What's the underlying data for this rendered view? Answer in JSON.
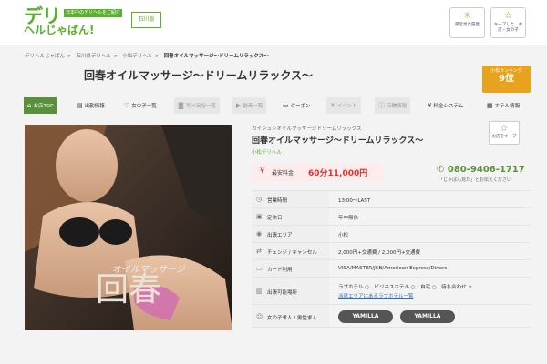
{
  "header": {
    "logo_main": "デリ",
    "logo_tag": "日本中のデリヘルをご紹介",
    "logo_second": "ヘルじゃぱん!",
    "area": "石川版",
    "history_btn": "最近見た履歴",
    "fav_list_btn": "キープした　お店・女の子"
  },
  "breadcrumb": [
    "デリヘルじゃぱん",
    "石川県デリヘル",
    "小松デリヘル",
    "回春オイルマッサージ〜ドリームリラックス〜"
  ],
  "title": "回春オイルマッサージ〜ドリームリラックス〜",
  "rank": {
    "label": "小松ランキング",
    "value": "9位"
  },
  "tabs": [
    {
      "label": "お店TOP",
      "icon": "home-icon"
    },
    {
      "label": "出勤情報",
      "icon": "calendar-icon"
    },
    {
      "label": "女の子一覧",
      "icon": "heart-icon"
    },
    {
      "label": "写メ日記一覧",
      "icon": "camera-icon"
    },
    {
      "label": "動画一覧",
      "icon": "video-icon"
    },
    {
      "label": "クーポン",
      "icon": "coupon-icon"
    },
    {
      "label": "イベント",
      "icon": "event-icon"
    },
    {
      "label": "店舗情報",
      "icon": "info-icon"
    },
    {
      "label": "料金システム",
      "icon": "yen-icon"
    },
    {
      "label": "ホテル情報",
      "icon": "hotel-icon"
    }
  ],
  "photo": {
    "caption_small": "オイルマッサージ",
    "caption_big": "回春"
  },
  "shop": {
    "kana": "カイシュンオイルマッサージドリームリラックス",
    "name": "回春オイルマッサージ〜ドリームリラックス〜",
    "genre": "小松デリヘル",
    "fav_label": "お店をキープ",
    "price_label": "最安料金",
    "price_value": "60分11,000円",
    "phone": "080-9406-1717",
    "phone_note": "「じゃぱん見た」とお伝えください"
  },
  "info": [
    {
      "key": "営業時間",
      "value": "13:00〜LAST",
      "icon": "clock-icon"
    },
    {
      "key": "定休日",
      "value": "年中無休",
      "icon": "calendar-off-icon"
    },
    {
      "key": "出張エリア",
      "value": "小松",
      "icon": "pin-icon"
    },
    {
      "key": "チェンジ / キャンセル",
      "value": "2,000円+交通費 / 2,000円+交通費",
      "icon": "swap-icon"
    },
    {
      "key": "カード利用",
      "value": "VISA/MASTER/JCB/American Express/Diners",
      "icon": "card-icon"
    },
    {
      "key": "出張可能場所",
      "value": "ラブホテル ○　ビジネスホテル ○　自宅 ○　待ち合わせ ×",
      "link": "派遣エリアにあるラブホテル一覧",
      "icon": "building-icon"
    },
    {
      "key": "女の子求人 / 男性求人",
      "icon": "person-icon",
      "badge1": "YAMILLA",
      "badge2": "YAMILLA"
    }
  ]
}
